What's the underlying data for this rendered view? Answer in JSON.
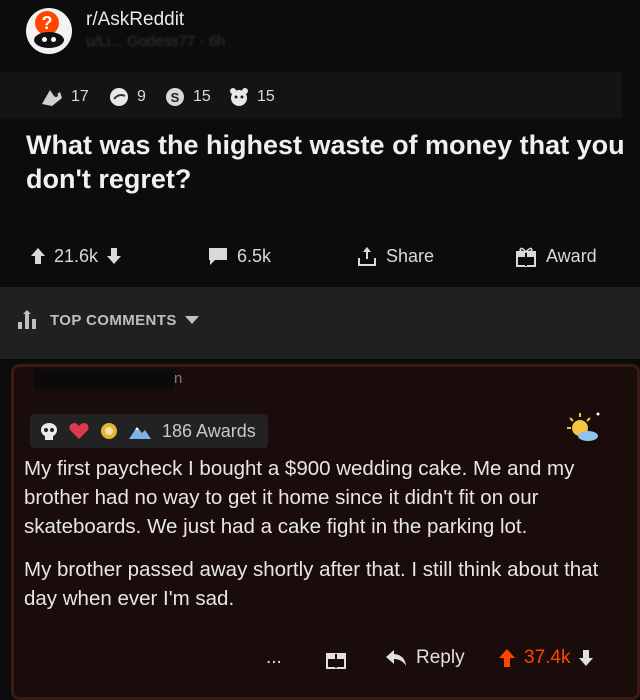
{
  "post": {
    "subreddit": "r/AskReddit",
    "author_line": "u/Li... Godess77 · 6h",
    "awards": [
      {
        "icon": "rocket-like-award-icon",
        "count": "17"
      },
      {
        "icon": "facepalm-award-icon",
        "count": "9"
      },
      {
        "icon": "silver-coin-award-icon",
        "count": "15"
      },
      {
        "icon": "wholesome-award-icon",
        "count": "15"
      }
    ],
    "title": "What was the highest waste of money that you don't regret?",
    "votes": "21.6k",
    "comments": "6.5k",
    "share_label": "Share",
    "award_label": "Award"
  },
  "sort": {
    "label": "TOP COMMENTS"
  },
  "comment": {
    "username_tail": "n",
    "awards_count": "186 Awards",
    "paragraphs": [
      "My first paycheck I bought a $900 wedding cake. Me and my brother had no way to get it home since it didn't fit on our skateboards. We just had a cake fight in the parking lot.",
      "My brother passed away shortly after that. I still think about that day when ever I'm sad."
    ],
    "more_label": "...",
    "reply_label": "Reply",
    "votes": "37.4k"
  },
  "colors": {
    "upvote": "#ff4500",
    "comment_bg": "#1a0c0b",
    "comment_border": "#3a1a17"
  }
}
